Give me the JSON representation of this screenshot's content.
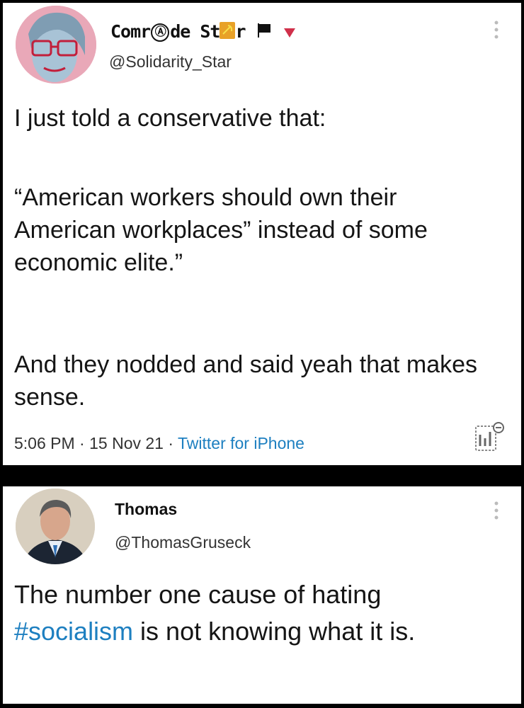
{
  "tweet1": {
    "display_name_prefix": "Comr",
    "display_name_mid": "de St",
    "display_name_suffix": "r",
    "handle": "@Solidarity_Star",
    "text_line1": "I just told a conservative that:",
    "text_quote": "“American workers should own their American workplaces” instead of some economic elite.”",
    "text_line3": "And they nodded and said yeah that makes sense.",
    "time": "5:06 PM",
    "date": "15 Nov 21",
    "source": "Twitter for iPhone",
    "separator": " · "
  },
  "tweet2": {
    "display_name": "Thomas",
    "handle": "@ThomasGruseck",
    "text_before": "The number one cause of hating ",
    "hashtag": "#socialism",
    "text_after": " is not knowing what it is."
  },
  "icons": {
    "badge_circle_a": "Ⓐ",
    "hammer_sickle_emoji": "hammer-sickle-icon",
    "black_flag_emoji": "black-flag-icon",
    "red_triangle_emoji": "red-triangle-icon",
    "more_options": "more-vertical-icon",
    "analytics": "analytics-icon"
  },
  "colors": {
    "link": "#1d7fc0",
    "background": "#000000",
    "card": "#ffffff",
    "text": "#151515"
  }
}
